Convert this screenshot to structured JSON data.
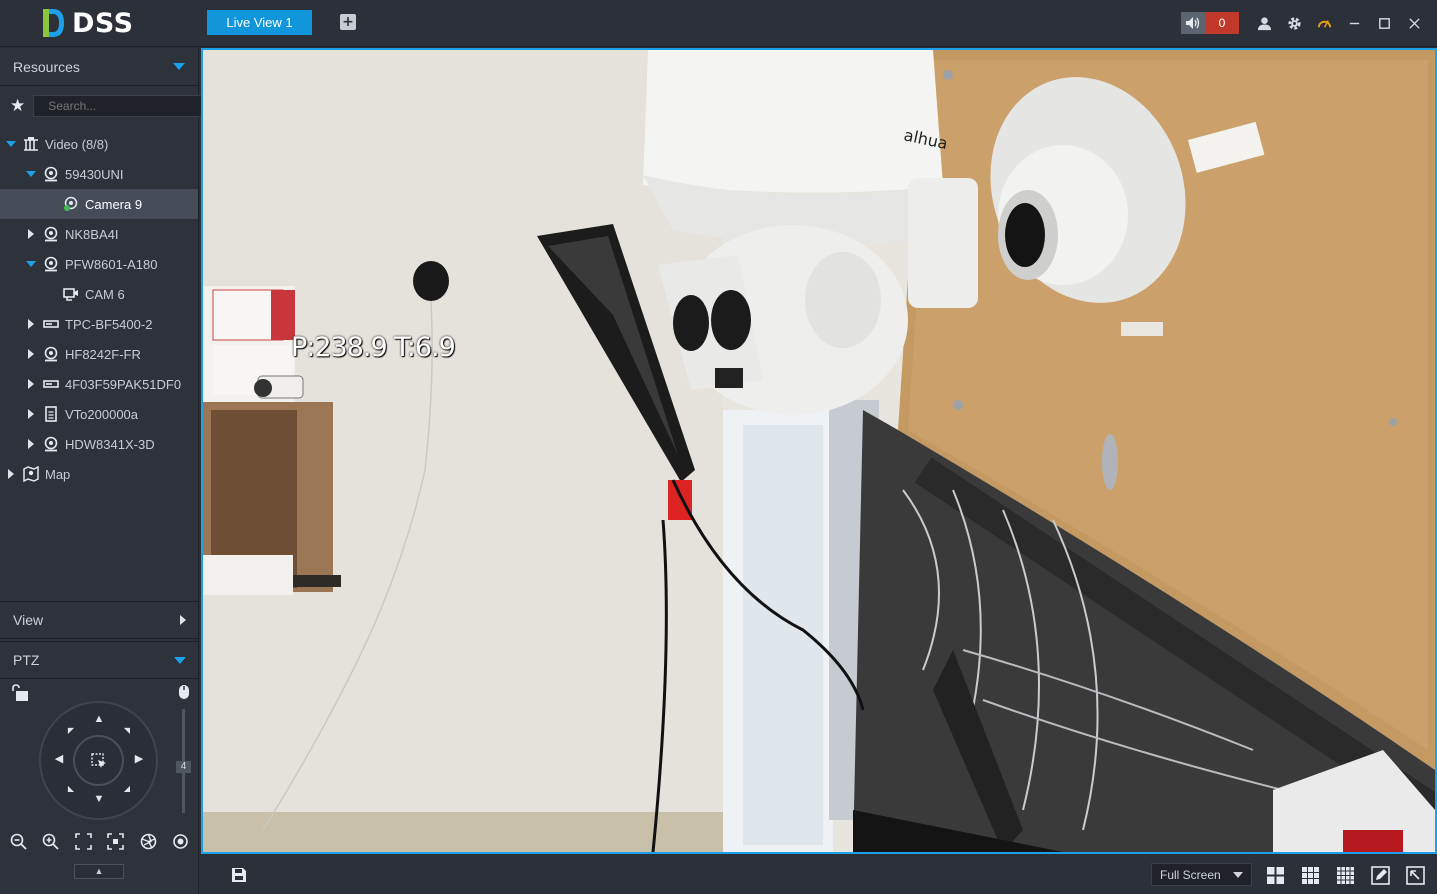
{
  "app": {
    "name": "DSS"
  },
  "tabs": [
    {
      "label": "Live View 1",
      "active": true
    }
  ],
  "titlebar": {
    "alarm_count": "0"
  },
  "sidebar": {
    "resources_label": "Resources",
    "search_placeholder": "Search...",
    "tree": [
      {
        "label": "Video (8/8)",
        "level": 0,
        "expanded": true,
        "icon": "video-tree-icon"
      },
      {
        "label": "59430UNI",
        "level": 1,
        "expanded": true,
        "icon": "dome-camera-icon"
      },
      {
        "label": "Camera 9",
        "level": 2,
        "selected": true,
        "icon": "camera-online-icon"
      },
      {
        "label": "NK8BA4I",
        "level": 1,
        "expanded": false,
        "icon": "dome-camera-icon"
      },
      {
        "label": "PFW8601-A180",
        "level": 1,
        "expanded": true,
        "icon": "dome-camera-icon"
      },
      {
        "label": "CAM 6",
        "level": 2,
        "icon": "channel-camera-icon"
      },
      {
        "label": "TPC-BF5400-2",
        "level": 1,
        "expanded": false,
        "icon": "nvr-icon"
      },
      {
        "label": "HF8242F-FR",
        "level": 1,
        "expanded": false,
        "icon": "dome-camera-icon"
      },
      {
        "label": "4F03F59PAK51DF0",
        "level": 1,
        "expanded": false,
        "icon": "nvr-icon"
      },
      {
        "label": "VTo200000a",
        "level": 1,
        "expanded": false,
        "icon": "intercom-icon"
      },
      {
        "label": "HDW8341X-3D",
        "level": 1,
        "expanded": false,
        "icon": "dome-camera-icon"
      },
      {
        "label": "Map",
        "level": 0,
        "expanded": false,
        "icon": "map-icon"
      }
    ],
    "view_label": "View",
    "ptz_label": "PTZ",
    "ptz_step": "4"
  },
  "video": {
    "osd_text": "P:238.9 T:6.9"
  },
  "bottombar": {
    "fullscreen_label": "Full Screen"
  },
  "colors": {
    "accent": "#1ea0e8",
    "tab_active": "#1296db",
    "alarm": "#c0392b",
    "panel_bg": "#2d323b"
  }
}
